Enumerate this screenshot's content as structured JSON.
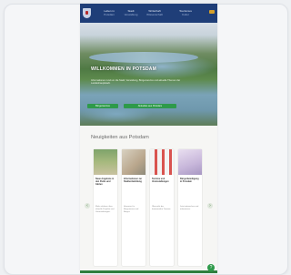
{
  "nav": {
    "items": [
      {
        "label": "Leben in",
        "sub": "Potsdam"
      },
      {
        "label": "Stadt",
        "sub": "Verwaltung"
      },
      {
        "label": "Wirtschaft",
        "sub": "Wissenschaft"
      },
      {
        "label": "Tourismus",
        "sub": "Kultur"
      }
    ]
  },
  "hero": {
    "title": "WILLKOMMEN IN POTSDAM",
    "text": "Informationen rund um die Stadt, Verwaltung, Bürgerservice und aktuelle Themen der Landeshauptstadt.",
    "button_left": "Bürgerservice",
    "button_right": "Aktuelles aus Potsdam"
  },
  "news": {
    "title": "Neuigkeiten aus Potsdam",
    "items": [
      {
        "title": "Neue Angebote in den Parks und Gärten",
        "text": "Mehr erfahren über aktuelle Projekte und Veranstaltungen."
      },
      {
        "title": "Informationen zur Stadtentwicklung",
        "text": "Hinweise für Bürgerinnen und Bürger."
      },
      {
        "title": "Termine und Veranstaltungen",
        "text": "Übersicht der kommenden Termine."
      },
      {
        "title": "Bürgerbeteiligung in Potsdam",
        "text": "Jetzt mitmachen und informieren."
      }
    ]
  },
  "colors": {
    "header": "#1f3e78",
    "accent": "#2e9a4a",
    "footer": "#2f7f3f"
  },
  "icons": {
    "logo": "city-crest-icon",
    "lang": "language-flag-icon",
    "prev": "chevron-left-icon",
    "next": "chevron-right-icon",
    "help": "chat-icon"
  }
}
